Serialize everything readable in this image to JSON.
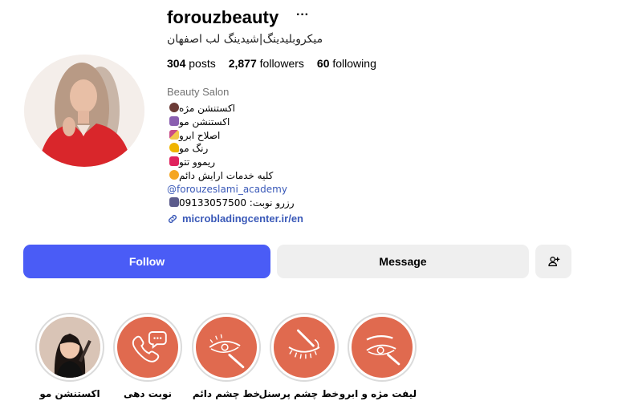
{
  "profile": {
    "username": "forouzbeauty",
    "more_icon": "ellipsis-icon",
    "subtitle": "میکروبلیدینگ|شیدینگ لب اصفهان",
    "stats": {
      "posts_count": "304",
      "posts_label": "posts",
      "followers_count": "2,877",
      "followers_label": "followers",
      "following_count": "60",
      "following_label": "following"
    },
    "category": "Beauty Salon",
    "bio": [
      "اکستنشن مژه",
      "اکستنشن مو",
      "اصلاح ابرو",
      "رنگ مو",
      "ریموو تتو",
      "کلیه خدمات ارایش دائم",
      "forouzeslami_academy@",
      "رزرو نوبت: 09133057500"
    ],
    "website": "microbladingcenter.ir/en"
  },
  "actions": {
    "follow": "Follow",
    "message": "Message",
    "add_user_icon": "person-add-icon"
  },
  "highlights": [
    {
      "label": "اکستنشن مو",
      "icon": "cartoon-portrait"
    },
    {
      "label": "نوبت دهی",
      "icon": "phone-chat-icon"
    },
    {
      "label": "خط چشم دائم",
      "icon": "eyeliner-icon"
    },
    {
      "label": "خط چشم پرسنل",
      "icon": "closed-eye-lashes-icon"
    },
    {
      "label": "لیفت مژه و ابرو",
      "icon": "brow-lift-icon"
    }
  ],
  "colors": {
    "follow_button": "#4a5cf6",
    "secondary_button": "#efefef",
    "link": "#3a59b8",
    "highlight_bg": "#e06a4f"
  }
}
